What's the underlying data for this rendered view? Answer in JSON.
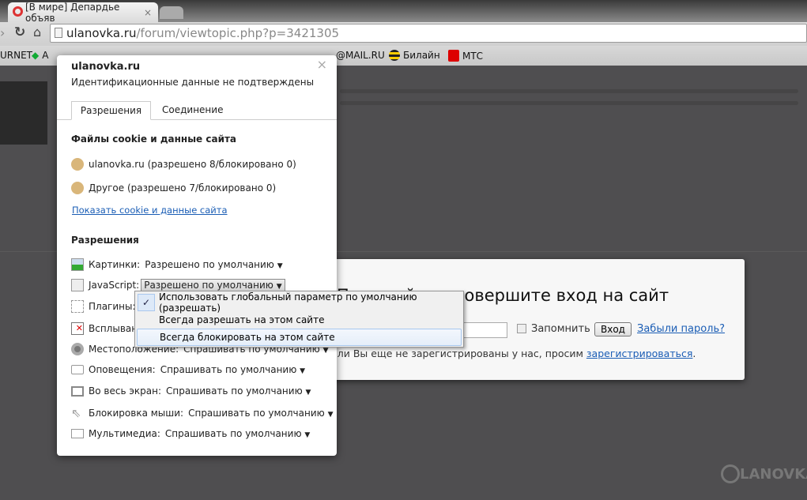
{
  "browser": {
    "tab_title": "[В мире] Депардье объяв",
    "url_host": "ulanovka.ru",
    "url_path": "/forum/viewtopic.php?p=3421305",
    "bookmarks": [
      "URNET",
      "A",
      "@MAIL.RU",
      "Билайн",
      "МТС"
    ]
  },
  "popup": {
    "site": "ulanovka.ru",
    "identity": "Идентификационные данные не подтверждены",
    "tabs": [
      "Разрешения",
      "Соединение"
    ],
    "active_tab": "Разрешения",
    "cookies_heading": "Файлы cookie и данные сайта",
    "cookies": [
      "ulanovka.ru (разрешено 8/блокировано 0)",
      "Другое (разрешено 7/блокировано 0)"
    ],
    "show_cookies_link": "Показать cookie и данные сайта",
    "permissions_heading": "Разрешения",
    "permissions": [
      {
        "label": "Картинки:",
        "value": "Разрешено по умолчанию",
        "icon": "image-icon"
      },
      {
        "label": "JavaScript:",
        "value": "Разрешено по умолчанию",
        "icon": "script-icon"
      },
      {
        "label": "Плагины:",
        "value": "",
        "icon": "puzzle-icon"
      },
      {
        "label": "Всплыван",
        "value": "",
        "icon": "popup-blocked-icon"
      },
      {
        "label": "Местоположение:",
        "value": "Спрашивать по умолчанию",
        "icon": "location-icon"
      },
      {
        "label": "Оповещения:",
        "value": "Спрашивать по умолчанию",
        "icon": "notification-icon"
      },
      {
        "label": "Во весь экран:",
        "value": "Спрашивать по умолчанию",
        "icon": "fullscreen-icon"
      },
      {
        "label": "Блокировка мыши:",
        "value": "Спрашивать по умолчанию",
        "icon": "cursor-icon"
      },
      {
        "label": "Мультимедиа:",
        "value": "Спрашивать по умолчанию",
        "icon": "camera-icon"
      }
    ]
  },
  "menu": {
    "items": [
      "Использовать глобальный параметр по умолчанию (разрешать)",
      "Всегда разрешать на этом сайте",
      "Всегда блокировать на этом сайте"
    ],
    "checked_index": 0,
    "hovered_index": 2
  },
  "login": {
    "title": "Пожалуйста, совершите вход на сайт",
    "remember": "Запомнить",
    "submit": "Вход",
    "forgot": "Забыли пароль?",
    "register_text": "Если Вы еще не зарегистрированы у нас, просим ",
    "register_link": "зарегистрироваться",
    "register_end": "."
  },
  "watermark": "LANOVKA"
}
